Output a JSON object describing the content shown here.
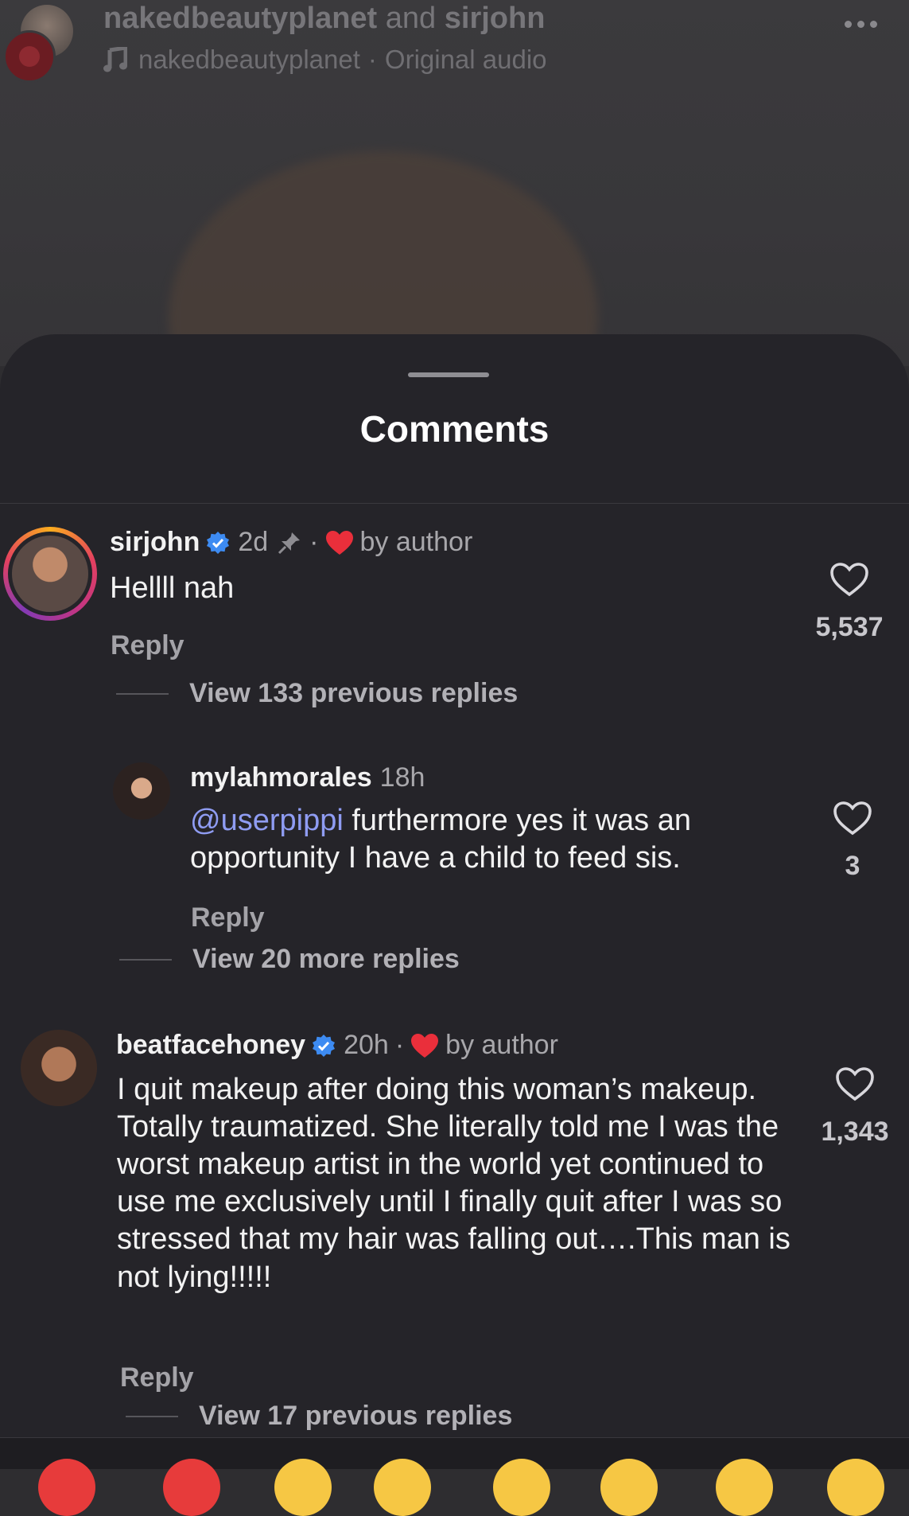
{
  "header": {
    "title_account1": "nakedbeautyplanet",
    "title_joiner": "and",
    "title_account2": "sirjohn",
    "audio_account": "nakedbeautyplanet",
    "audio_separator": "·",
    "audio_label": "Original audio"
  },
  "sheet": {
    "title": "Comments"
  },
  "comments": [
    {
      "username": "sirjohn",
      "time": "2d",
      "separator": "·",
      "liked_by": "by author",
      "text": "Hellll nah",
      "reply": "Reply",
      "likes": "5,537",
      "view_replies": "View 133 previous replies"
    },
    {
      "username": "mylahmorales",
      "time": "18h",
      "mention": "@userpippi",
      "text": " furthermore yes it was an opportunity I have a child to feed sis.",
      "reply": "Reply",
      "likes": "3",
      "view_replies": "View 20 more replies"
    },
    {
      "username": "beatfacehoney",
      "time": "20h",
      "separator": "·",
      "liked_by": "by author",
      "text": "I quit makeup after doing this woman’s makeup. Totally traumatized. She literally told me I was the worst makeup artist in the world yet continued to use me exclusively until I finally quit after I was so stressed that my hair was falling out….This man is not lying!!!!!",
      "reply": "Reply",
      "likes": "1,343",
      "view_replies": "View 17 previous replies"
    }
  ],
  "colors": {
    "sheet_bg": "#252429",
    "verified": "#3d8bf2",
    "heart_red": "#ea2f3b",
    "mention": "#8f9cf2"
  }
}
